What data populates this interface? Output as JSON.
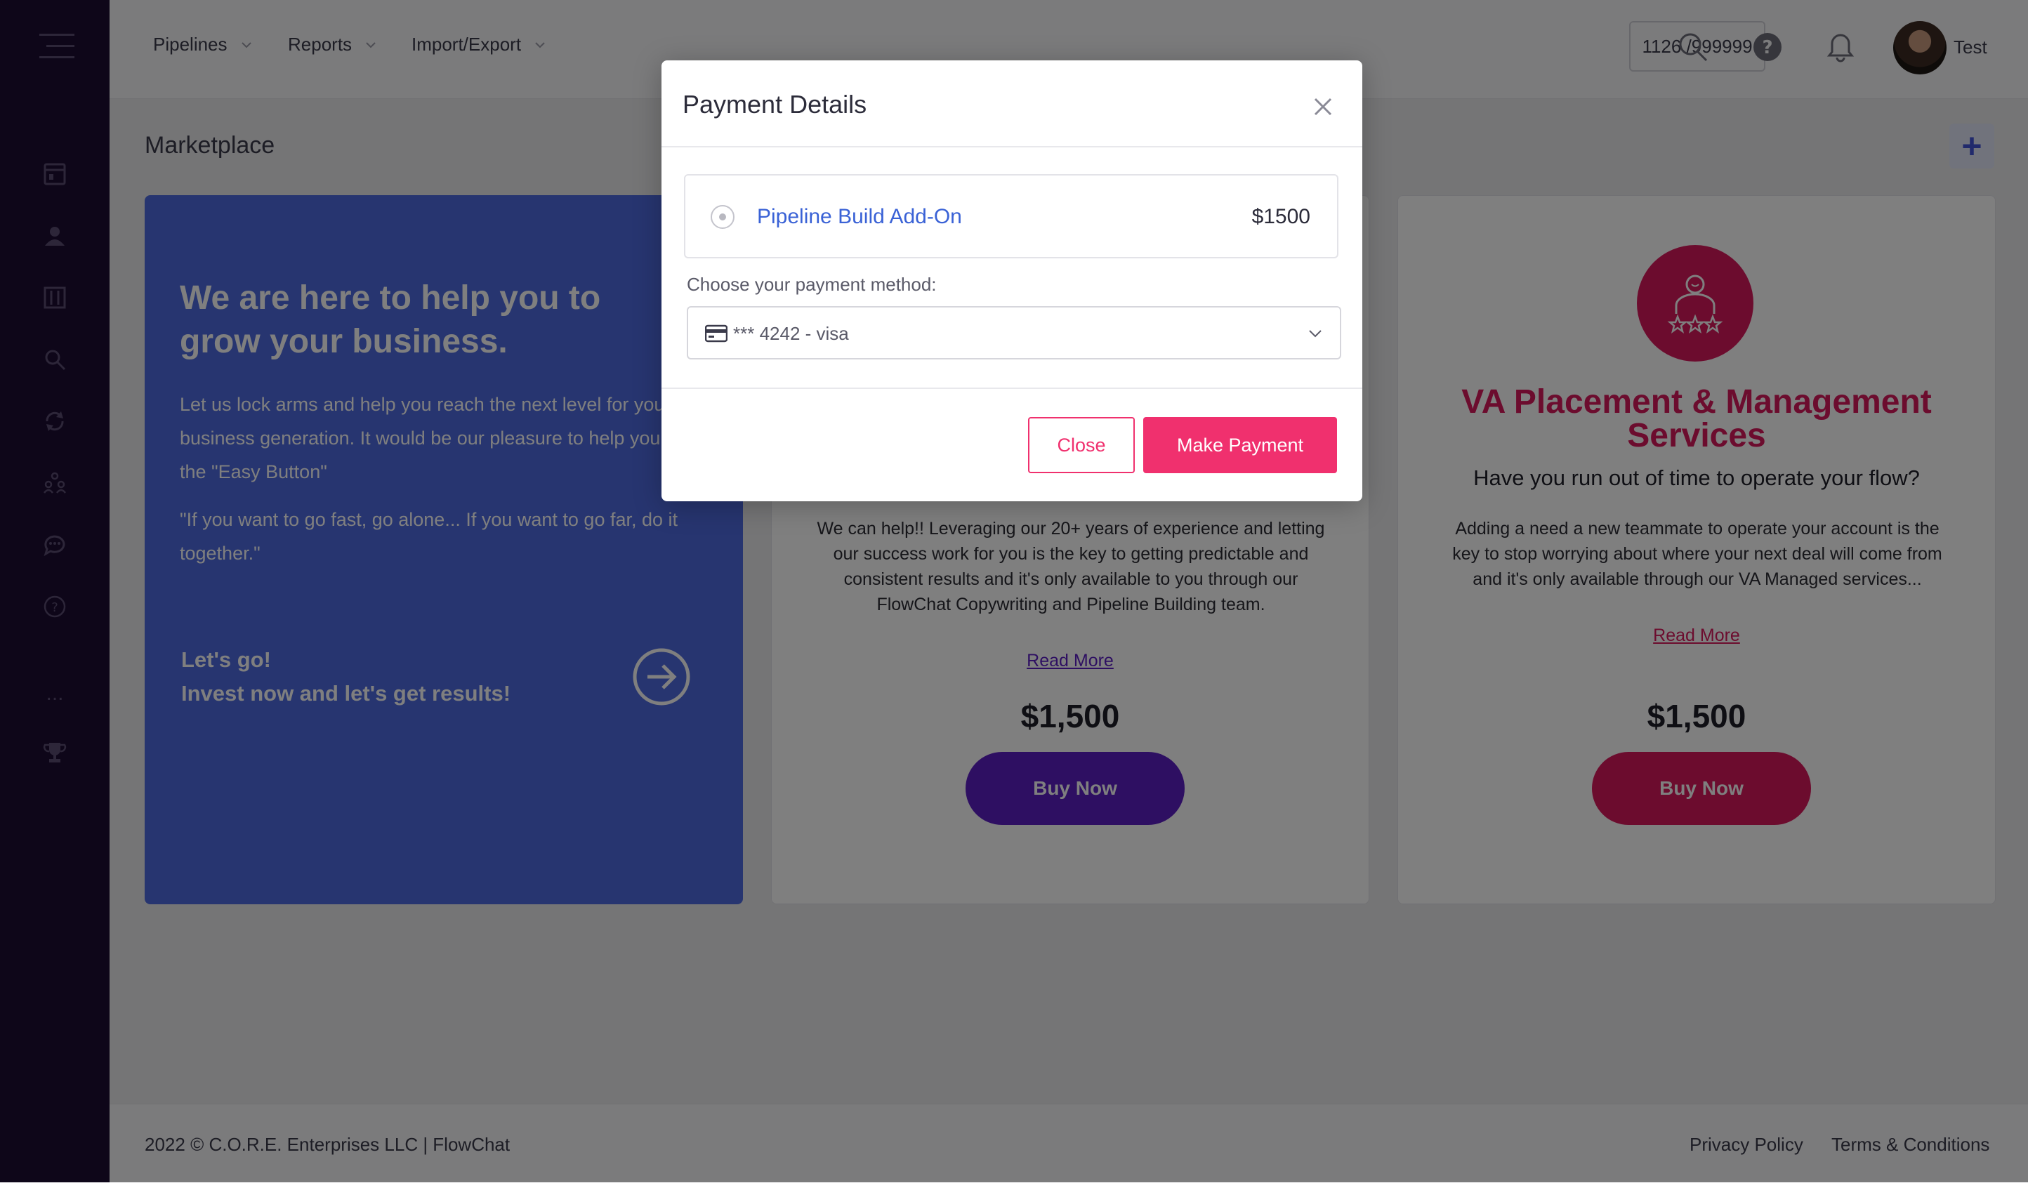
{
  "nav": {
    "items": [
      {
        "label": "Pipelines"
      },
      {
        "label": "Reports"
      },
      {
        "label": "Import/Export"
      }
    ],
    "counter": "1126 /999999",
    "user_name": "Test"
  },
  "sidebar": {
    "icons": [
      "menu-icon",
      "dashboard-icon",
      "contacts-icon",
      "board-icon",
      "search-icon",
      "sync-icon",
      "team-icon",
      "chat-icon",
      "help-icon",
      "more-icon",
      "trophy-icon"
    ],
    "more_label": "..."
  },
  "page": {
    "title": "Marketplace",
    "add_label": "+"
  },
  "hero": {
    "title": "We are here to help you to grow your business.",
    "text": "Let us lock arms and help you reach the next level for your business generation. It would be our pleasure to help you push the \"Easy Button\"",
    "quote": "\"If you want to go fast, go alone... If you want to go far, do it together.\"",
    "cta_line1": "Let's go!",
    "cta_line2": "Invest now and let's get results!"
  },
  "card_mid": {
    "description": "We can help!! Leveraging our 20+ years of experience and letting our success work for you is the key to getting predictable and consistent results and it's only available to you through our FlowChat Copywriting and Pipeline Building team.",
    "read_more": "Read More",
    "price": "$1,500",
    "buy_label": "Buy Now",
    "color": "#5c1fc4"
  },
  "card_right": {
    "title": "VA Placement & Management Services",
    "subtitle": "Have you run out of time to operate your flow?",
    "description": "Adding a need a new teammate to operate your account is the key to stop worrying about where your next deal will come from and it's only available through our VA Managed services...",
    "read_more": "Read More",
    "price": "$1,500",
    "buy_label": "Buy Now",
    "color": "#d8195c"
  },
  "footer": {
    "copyright": "2022 © C.O.R.E. Enterprises LLC | FlowChat",
    "privacy": "Privacy Policy",
    "terms": "Terms & Conditions"
  },
  "modal": {
    "title": "Payment Details",
    "product_name": "Pipeline Build Add-On",
    "product_price": "$1500",
    "payment_label": "Choose your payment method:",
    "payment_value": "*** 4242 - visa",
    "close_label": "Close",
    "pay_label": "Make Payment",
    "accent": "#f0306e"
  }
}
